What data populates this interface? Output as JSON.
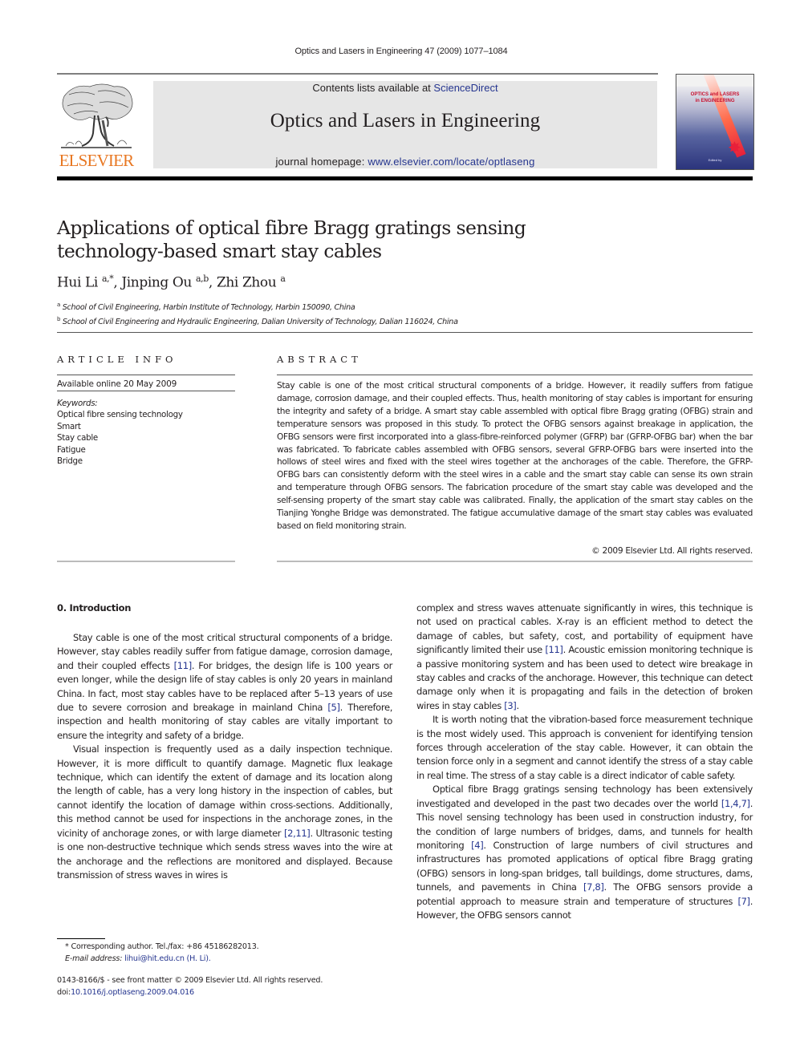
{
  "running_header": "Optics and Lasers in Engineering 47 (2009) 1077–1084",
  "masthead": {
    "publisher_logo_text": "ELSEVIER",
    "contents_prefix": "Contents lists available at ",
    "contents_link": "ScienceDirect",
    "journal_title": "Optics and Lasers in Engineering",
    "homepage_prefix": "journal homepage: ",
    "homepage_link": "www.elsevier.com/locate/optlaseng",
    "cover_title_line1": "OPTICS and LASERS",
    "cover_title_line2": "in ENGINEERING",
    "cover_editor": "Edited by"
  },
  "article": {
    "title": "Applications of optical fibre Bragg gratings sensing technology-based smart stay cables",
    "authors": [
      {
        "name": "Hui Li",
        "sup": "a,*"
      },
      {
        "name": "Jinping Ou",
        "sup": "a,b"
      },
      {
        "name": "Zhi Zhou",
        "sup": "a"
      }
    ],
    "affiliations": [
      {
        "mark": "a",
        "text": "School of Civil Engineering, Harbin Institute of Technology, Harbin 150090, China"
      },
      {
        "mark": "b",
        "text": "School of Civil Engineering and Hydraulic Engineering, Dalian University of Technology, Dalian 116024, China"
      }
    ]
  },
  "article_info": {
    "heading": "ARTICLE INFO",
    "available": "Available online 20 May 2009",
    "keywords_label": "Keywords:",
    "keywords": [
      "Optical fibre sensing technology",
      "Smart",
      "Stay cable",
      "Fatigue",
      "Bridge"
    ]
  },
  "abstract": {
    "heading": "ABSTRACT",
    "text": "Stay cable is one of the most critical structural components of a bridge. However, it readily suffers from fatigue damage, corrosion damage, and their coupled effects. Thus, health monitoring of stay cables is important for ensuring the integrity and safety of a bridge. A smart stay cable assembled with optical fibre Bragg grating (OFBG) strain and temperature sensors was proposed in this study. To protect the OFBG sensors against breakage in application, the OFBG sensors were first incorporated into a glass-fibre-reinforced polymer (GFRP) bar (GFRP-OFBG bar) when the bar was fabricated. To fabricate cables assembled with OFBG sensors, several GFRP-OFBG bars were inserted into the hollows of steel wires and fixed with the steel wires together at the anchorages of the cable. Therefore, the GFRP-OFBG bars can consistently deform with the steel wires in a cable and the smart stay cable can sense its own strain and temperature through OFBG sensors. The fabrication procedure of the smart stay cable was developed and the self-sensing property of the smart stay cable was calibrated. Finally, the application of the smart stay cables on the Tianjing Yonghe Bridge was demonstrated. The fatigue accumulative damage of the smart stay cables was evaluated based on field monitoring strain.",
    "copyright": "© 2009 Elsevier Ltd. All rights reserved."
  },
  "body": {
    "section_heading": "0.  Introduction",
    "left_paragraphs": [
      [
        {
          "t": "Stay cable is one of the most critical structural components of a bridge. However, stay cables readily suffer from fatigue damage, corrosion damage, and their coupled effects "
        },
        {
          "ref": "[11]"
        },
        {
          "t": ". For bridges, the design life is 100 years or even longer, while the design life of stay cables is only 20 years in mainland China. In fact, most stay cables have to be replaced after 5–13 years of use due to severe corrosion and breakage in mainland China "
        },
        {
          "ref": "[5]"
        },
        {
          "t": ". Therefore, inspection and health monitoring of stay cables are vitally important to ensure the integrity and safety of a bridge."
        }
      ],
      [
        {
          "t": "Visual inspection is frequently used as a daily inspection technique. However, it is more difficult to quantify damage. Magnetic flux leakage technique, which can identify the extent of damage and its location along the length of cable, has a very long history in the inspection of cables, but cannot identify the location of damage within cross-sections. Additionally, this method cannot be used for inspections in the anchorage zones, in the vicinity of anchorage zones, or with large diameter "
        },
        {
          "ref": "[2,11]"
        },
        {
          "t": ". Ultrasonic testing is one non-destructive technique which sends stress waves into the wire at the anchorage and the reflections are monitored and displayed. Because transmission of stress waves in wires is"
        }
      ]
    ],
    "right_paragraphs": [
      [
        {
          "t": "complex and stress waves attenuate significantly in wires, this technique is not used on practical cables. X-ray is an efficient method to detect the damage of cables, but safety, cost, and portability of equipment have significantly limited their use "
        },
        {
          "ref": "[11]"
        },
        {
          "t": ". Acoustic emission monitoring technique is a passive monitoring system and has been used to detect wire breakage in stay cables and cracks of the anchorage. However, this technique can detect damage only when it is propagating and fails in the detection of broken wires in stay cables "
        },
        {
          "ref": "[3]"
        },
        {
          "t": "."
        }
      ],
      [
        {
          "t": "It is worth noting that the vibration-based force measurement technique is the most widely used. This approach is convenient for identifying tension forces through acceleration of the stay cable. However, it can obtain the tension force only in a segment and cannot identify the stress of a stay cable in real time. The stress of a stay cable is a direct indicator of cable safety."
        }
      ],
      [
        {
          "t": "Optical fibre Bragg gratings sensing technology has been extensively investigated and developed in the past two decades over the world "
        },
        {
          "ref": "[1,4,7]"
        },
        {
          "t": ". This novel sensing technology has been used in construction industry, for the condition of large numbers of bridges, dams, and tunnels for health monitoring "
        },
        {
          "ref": "[4]"
        },
        {
          "t": ". Construction of large numbers of civil structures and infrastruc­tures has promoted applications of optical fibre Bragg grating (OFBG) sensors in long-span bridges, tall buildings, dome structures, dams, tunnels, and pavements in China "
        },
        {
          "ref": "[7,8]"
        },
        {
          "t": ". The OFBG sensors provide a potential approach to measure strain and temperature of structures "
        },
        {
          "ref": "[7]"
        },
        {
          "t": ". However, the OFBG sensors cannot"
        }
      ]
    ]
  },
  "footnotes": {
    "corresponding": "* Corresponding author. Tel./fax: +86 45186282013.",
    "email_label": "E-mail address:",
    "email_link": "lihui@hit.edu.cn (H. Li).",
    "issn_line": "0143-8166/$ - see front matter © 2009 Elsevier Ltd. All rights reserved.",
    "doi_prefix": "doi:",
    "doi_link": "10.1016/j.optlaseng.2009.04.016"
  },
  "colors": {
    "link": "#25358f",
    "elsevier_orange": "#e87722",
    "masthead_bg": "#e6e6e6"
  }
}
